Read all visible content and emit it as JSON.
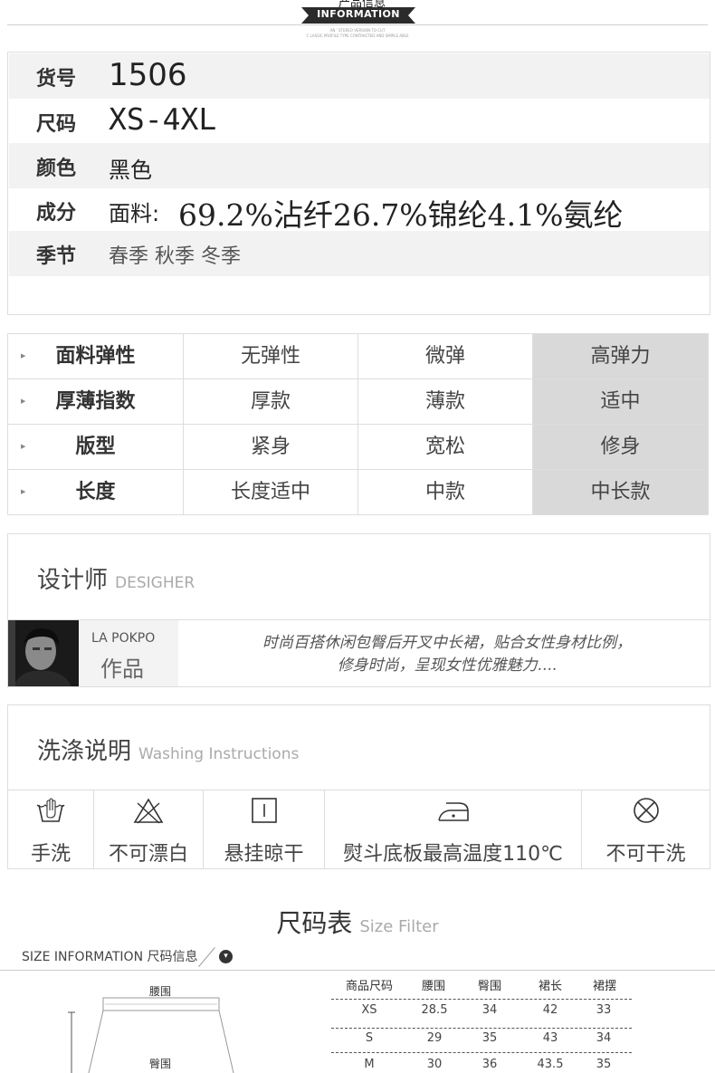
{
  "header": {
    "top_text": "产品信息",
    "badge": "INFORMATION",
    "sub_lines": [
      "AN ' STEREO VERSION TO CUT",
      "C LASSIC PROFILE TYPE CONTRACTED AND SIMPLE ABLE"
    ]
  },
  "info": {
    "rows": [
      {
        "label": "货号",
        "value": "1506"
      },
      {
        "label": "尺码",
        "value": "XS-4XL"
      },
      {
        "label": "颜色",
        "value": "黑色"
      },
      {
        "label": "成分",
        "value_prefix": "面料:",
        "value": "69.2%沾纤26.7%锦纶4.1%氨纶"
      },
      {
        "label": "季节",
        "value": "春季 秋季 冬季"
      }
    ]
  },
  "attributes": {
    "rows": [
      {
        "name": "面料弹性",
        "options": [
          "无弹性",
          "微弹",
          "高弹力"
        ],
        "selected": 2
      },
      {
        "name": "厚薄指数",
        "options": [
          "厚款",
          "薄款",
          "适中"
        ],
        "selected": 2
      },
      {
        "name": "版型",
        "options": [
          "紧身",
          "宽松",
          "修身"
        ],
        "selected": 2
      },
      {
        "name": "长度",
        "options": [
          "长度适中",
          "中款",
          "中长款"
        ],
        "selected": 2
      }
    ],
    "selected_color": "#d9d9d9"
  },
  "designer": {
    "title": "设计师",
    "subtitle": "DESIGHER",
    "name": "LA POKPO",
    "works": "作品",
    "quote_lines": [
      "时尚百搭休闲包臀后开叉中长裙，贴合女性身材比例，",
      "修身时尚，呈现女性优雅魅力...."
    ]
  },
  "washing": {
    "title": "洗涤说明",
    "subtitle": "Washing Instructions",
    "items": [
      {
        "icon": "hand-wash-icon",
        "label": "手洗"
      },
      {
        "icon": "no-bleach-icon",
        "label": "不可漂白"
      },
      {
        "icon": "hang-dry-icon",
        "label": "悬挂晾干"
      },
      {
        "icon": "iron-icon",
        "label": "熨斗底板最高温度110℃"
      },
      {
        "icon": "no-dry-clean-icon",
        "label": "不可干洗"
      }
    ]
  },
  "size_chart": {
    "title": "尺码表",
    "subtitle": "Size Filter",
    "info_label": "SIZE INFORMATION 尺码信息",
    "diagram_labels": {
      "waist": "腰围",
      "hip": "臀围"
    },
    "headers": [
      "商品尺码",
      "腰围",
      "臀围",
      "裙长",
      "裙摆"
    ],
    "rows": [
      [
        "XS",
        "28.5",
        "34",
        "42",
        "33"
      ],
      [
        "S",
        "29",
        "35",
        "43",
        "34"
      ],
      [
        "M",
        "30",
        "36",
        "43.5",
        "35"
      ]
    ]
  }
}
